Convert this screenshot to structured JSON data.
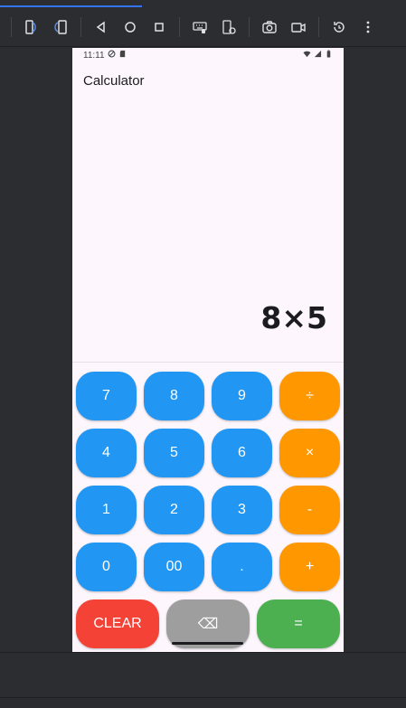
{
  "emulator": {
    "loading_progress": 0.35,
    "toolbar": [
      {
        "name": "fold-icon"
      },
      {
        "name": "rotate-icon"
      },
      {
        "name": "back-icon"
      },
      {
        "name": "home-icon"
      },
      {
        "name": "overview-icon"
      },
      {
        "name": "keyboard-icon"
      },
      {
        "name": "device-settings-icon"
      },
      {
        "name": "camera-icon"
      },
      {
        "name": "video-icon"
      },
      {
        "name": "snapshot-icon"
      },
      {
        "name": "more-icon"
      }
    ]
  },
  "status": {
    "time": "11:11"
  },
  "app": {
    "title": "Calculator"
  },
  "display": {
    "expression": "8×5"
  },
  "keys": {
    "k7": "7",
    "k8": "8",
    "k9": "9",
    "div": "÷",
    "k4": "4",
    "k5": "5",
    "k6": "6",
    "mul": "×",
    "k1": "1",
    "k2": "2",
    "k3": "3",
    "sub": "-",
    "k0": "0",
    "k00": "00",
    "dot": ".",
    "add": "+",
    "clear": "CLEAR",
    "backspace": "⌫",
    "equals": "="
  },
  "colors": {
    "number_key": "#2196f3",
    "operator_key": "#ff9800",
    "clear_key": "#f44336",
    "backspace_key": "#9e9e9e",
    "equals_key": "#4caf50",
    "accent": "#3574f0"
  }
}
